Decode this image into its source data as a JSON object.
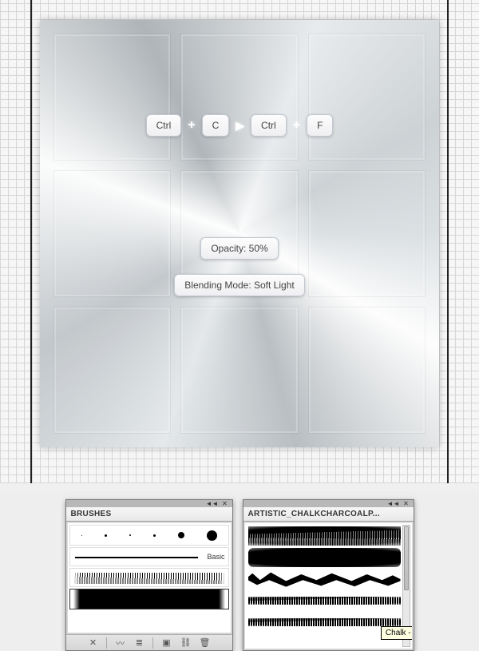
{
  "shortcut": {
    "key1": "Ctrl",
    "key2": "C",
    "key3": "Ctrl",
    "key4": "F"
  },
  "labels": {
    "opacity": "Opacity: 50%",
    "blending": "Blending Mode: Soft Light"
  },
  "panels": {
    "brushes": {
      "title": "BRUSHES",
      "basic_label": "Basic"
    },
    "artistic": {
      "title": "ARTISTIC_CHALKCHARCOALP...",
      "tooltip": "Chalk - Scribble"
    }
  }
}
